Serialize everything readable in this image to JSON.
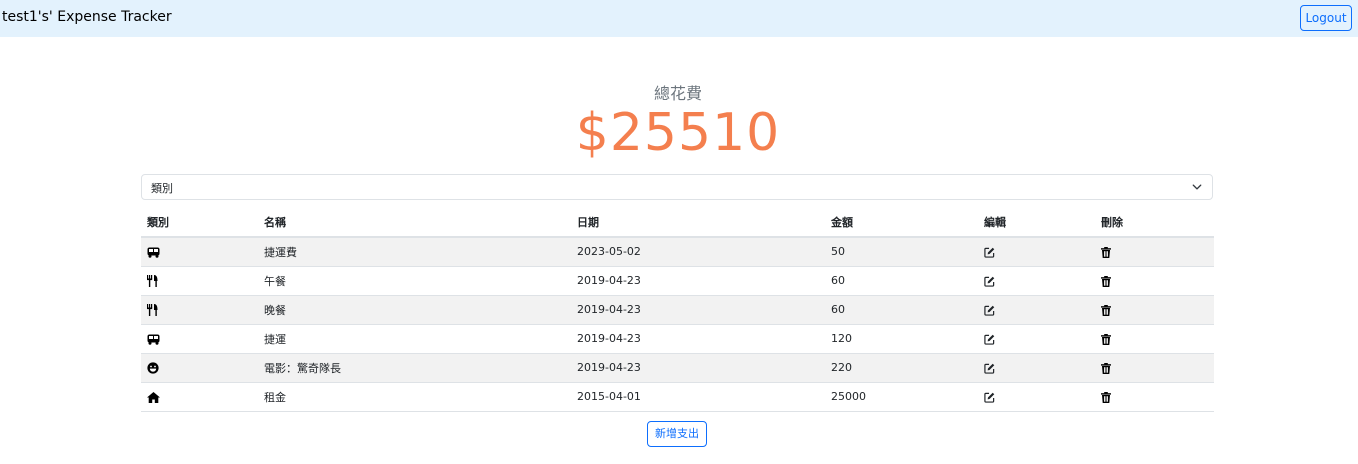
{
  "navbar": {
    "brand": "test1's' Expense Tracker",
    "logout_label": "Logout"
  },
  "summary": {
    "label": "總花費",
    "total": "$25510"
  },
  "filter": {
    "selected": "類別"
  },
  "table": {
    "headers": {
      "category": "類別",
      "name": "名稱",
      "date": "日期",
      "amount": "金額",
      "edit": "編輯",
      "delete": "刪除"
    },
    "rows": [
      {
        "category_icon": "bus-icon",
        "name": "捷運費",
        "date": "2023-05-02",
        "amount": "50"
      },
      {
        "category_icon": "utensils-icon",
        "name": "午餐",
        "date": "2019-04-23",
        "amount": "60"
      },
      {
        "category_icon": "utensils-icon",
        "name": "晚餐",
        "date": "2019-04-23",
        "amount": "60"
      },
      {
        "category_icon": "bus-icon",
        "name": "捷運",
        "date": "2019-04-23",
        "amount": "120"
      },
      {
        "category_icon": "smile-icon",
        "name": "電影：驚奇隊長",
        "date": "2019-04-23",
        "amount": "220"
      },
      {
        "category_icon": "home-icon",
        "name": "租金",
        "date": "2015-04-01",
        "amount": "25000"
      }
    ]
  },
  "add_button_label": "新增支出",
  "colors": {
    "navbar_bg": "#e3f2fd",
    "primary": "#0d6efd",
    "total_amount": "#f47f4e",
    "stripe": "#f2f2f2"
  }
}
